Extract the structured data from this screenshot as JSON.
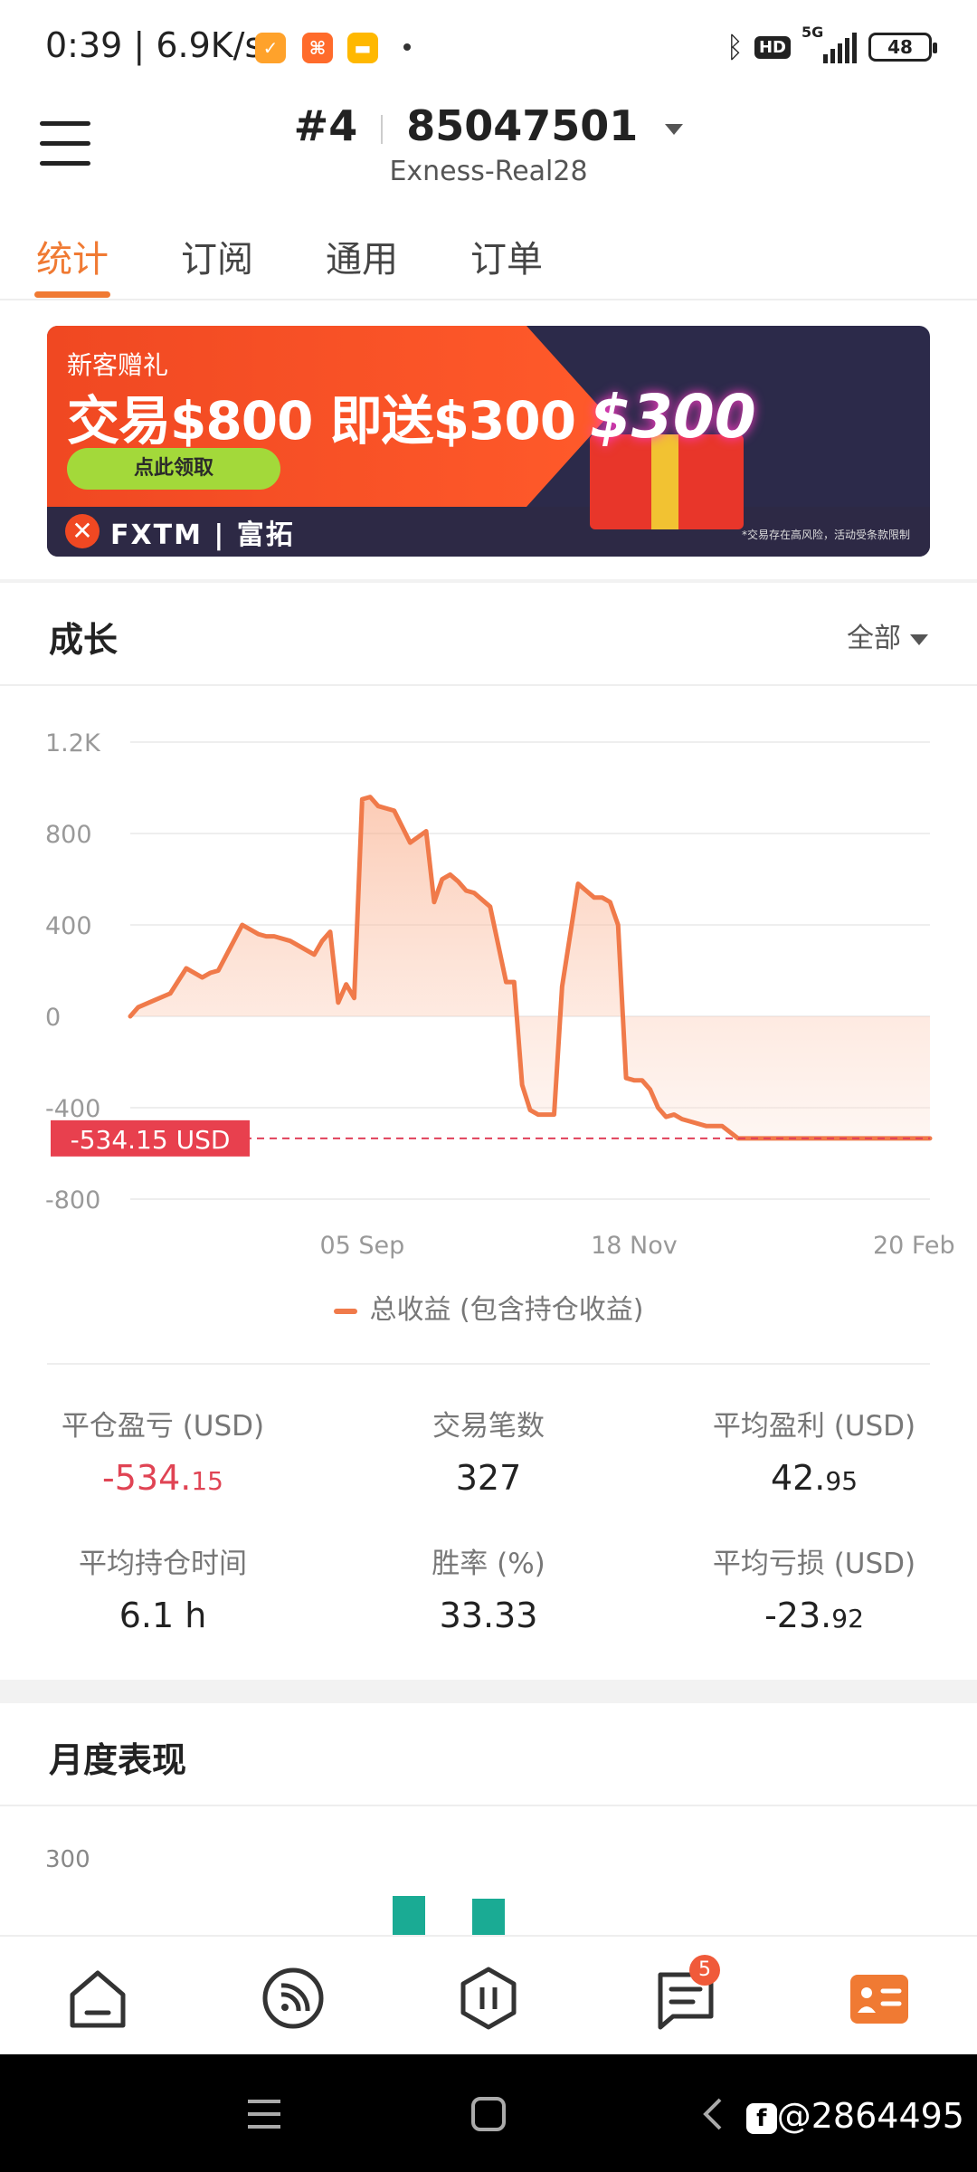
{
  "status_bar": {
    "time": "0:39",
    "net_speed": "6.9K/s",
    "battery": "48",
    "network": "5G",
    "hd": "HD"
  },
  "header": {
    "account_number": "#4",
    "account_id": "85047501",
    "server": "Exness-Real28"
  },
  "tabs": [
    {
      "label": "统计",
      "active": true
    },
    {
      "label": "订阅",
      "active": false
    },
    {
      "label": "通用",
      "active": false
    },
    {
      "label": "订单",
      "active": false
    }
  ],
  "banner": {
    "line1": "新客赠礼",
    "line2": "交易$800 即送$300",
    "button": "点此领取",
    "brand": "FXTM | 富拓",
    "promo_amount": "$300",
    "disclaimer": "*交易存在高风险，活动受条款限制"
  },
  "growth": {
    "title": "成长",
    "range": "全部",
    "current_label": "-534.15 USD",
    "legend": "总收益 (包含持仓收益)"
  },
  "chart_data": {
    "type": "area",
    "title": "",
    "xlabel": "",
    "ylabel": "",
    "ylim": [
      -800,
      1200
    ],
    "yticks": [
      "1.2K",
      "800",
      "400",
      "0",
      "-400",
      "-800"
    ],
    "ytick_values": [
      1200,
      800,
      400,
      0,
      -400,
      -800
    ],
    "xticks": [
      "05 Sep",
      "18 Nov",
      "20 Feb"
    ],
    "xtick_positions": [
      0.29,
      0.63,
      0.98
    ],
    "current_value": -534.15,
    "series": [
      {
        "name": "总收益 (包含持仓收益)",
        "color": "#f07a4a",
        "x": [
          0,
          0.01,
          0.03,
          0.05,
          0.07,
          0.09,
          0.1,
          0.11,
          0.14,
          0.16,
          0.17,
          0.18,
          0.2,
          0.23,
          0.24,
          0.25,
          0.26,
          0.27,
          0.28,
          0.29,
          0.3,
          0.31,
          0.33,
          0.35,
          0.37,
          0.38,
          0.39,
          0.4,
          0.41,
          0.42,
          0.43,
          0.45,
          0.47,
          0.48,
          0.49,
          0.5,
          0.51,
          0.53,
          0.54,
          0.56,
          0.57,
          0.58,
          0.59,
          0.6,
          0.61,
          0.62,
          0.63,
          0.64,
          0.65,
          0.66,
          0.67,
          0.68,
          0.69,
          0.7,
          0.72,
          0.73,
          0.74,
          0.76,
          0.78,
          0.79,
          0.8,
          0.81,
          0.82,
          0.83,
          0.84,
          0.86,
          0.88,
          0.9,
          0.92,
          0.94,
          0.96,
          0.97,
          0.99,
          1.0
        ],
        "values": [
          0,
          40,
          70,
          100,
          210,
          170,
          190,
          200,
          400,
          360,
          350,
          350,
          330,
          270,
          330,
          370,
          60,
          140,
          80,
          950,
          960,
          920,
          900,
          760,
          810,
          500,
          600,
          620,
          590,
          550,
          540,
          480,
          150,
          150,
          -300,
          -410,
          -430,
          -430,
          130,
          580,
          550,
          520,
          520,
          500,
          400,
          -270,
          -280,
          -280,
          -320,
          -400,
          -440,
          -430,
          -450,
          -460,
          -480,
          -480,
          -480,
          -534.15,
          -534.15,
          -534.15,
          -534.15,
          -534.15,
          -534.15,
          -534.15,
          -534.15,
          -534.15,
          -534.15,
          -534.15,
          -534.15,
          -534.15,
          -534.15,
          -534.15,
          -534.15,
          -534.15
        ]
      }
    ]
  },
  "stats": [
    {
      "label": "平仓盈亏 (USD)",
      "main": "-534.",
      "small": "15",
      "negative_red": true
    },
    {
      "label": "交易笔数",
      "main": "327",
      "small": "",
      "negative_red": false
    },
    {
      "label": "平均盈利 (USD)",
      "main": "42.",
      "small": "95",
      "negative_red": false
    },
    {
      "label": "平均持仓时间",
      "main": "6.1 h",
      "small": "",
      "negative_red": false
    },
    {
      "label": "胜率 (%)",
      "main": "33.33",
      "small": "",
      "negative_red": false
    },
    {
      "label": "平均亏损 (USD)",
      "main": "-23.",
      "small": "92",
      "negative_red": false
    }
  ],
  "monthly": {
    "title": "月度表现",
    "ytick": "300",
    "bar_color": "#1aab94"
  },
  "bottom_nav": {
    "badge_count": "5",
    "active_color": "#f07a33"
  },
  "watermark": "@2864495"
}
